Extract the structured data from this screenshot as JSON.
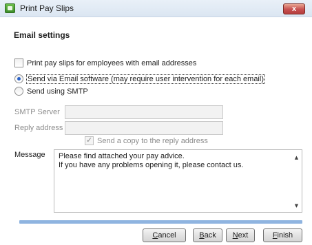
{
  "window": {
    "title": "Print Pay Slips",
    "close_label": "x"
  },
  "header": {
    "title": "Email settings"
  },
  "options": {
    "print_email_employees": {
      "label": "Print pay slips for employees with email addresses",
      "checked": false
    },
    "send_method": {
      "email_software_label": "Send via Email software (may require user intervention for each email)",
      "smtp_label": "Send using SMTP",
      "selected": "email_software"
    }
  },
  "smtp": {
    "server_label": "SMTP Server",
    "server_value": "",
    "reply_label": "Reply address",
    "reply_value": "",
    "copy_label": "Send a copy to the reply address",
    "copy_checked": true
  },
  "message": {
    "label": "Message",
    "line1": "Please find attached your pay advice.",
    "line2": "If you have any problems opening it, please contact us."
  },
  "progress": {
    "fraction": 1.0
  },
  "buttons": {
    "cancel": {
      "accel": "C",
      "rest": "ancel"
    },
    "back": {
      "accel": "B",
      "rest": "ack"
    },
    "next": {
      "accel": "N",
      "rest": "ext"
    },
    "finish": {
      "accel": "F",
      "rest": "inish"
    }
  }
}
